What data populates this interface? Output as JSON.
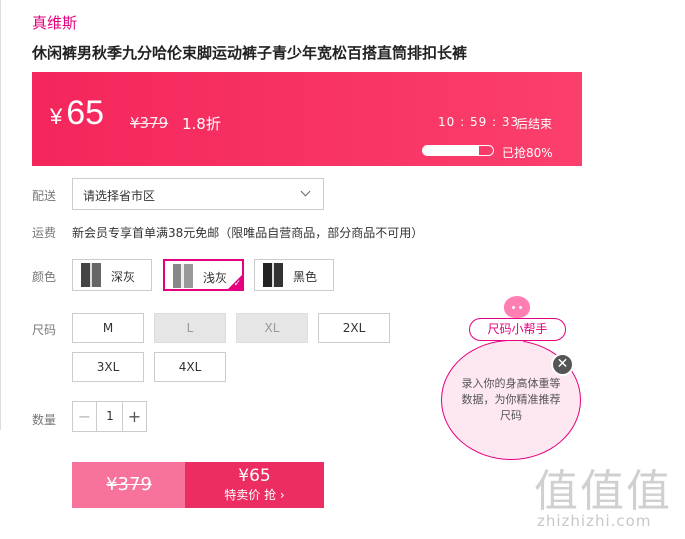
{
  "brand": "真维斯",
  "product_title": "休闲裤男秋季九分哈伦束脚运动裤子青少年宽松百搭直筒排扣长裤",
  "banner": {
    "currency": "¥",
    "price": "65",
    "original_price": "¥379",
    "discount": "1.8折",
    "countdown": "10 : 59 : 33",
    "ends_label": "后结束",
    "sold_label": "已抢80%",
    "sold_fraction": 0.8,
    "colors": {
      "start": "#f4265b",
      "end": "#fb3f6c"
    }
  },
  "delivery": {
    "label": "配送",
    "select_value": "请选择省市区"
  },
  "shipping": {
    "label": "运费",
    "text": "新会员专享首单满38元免邮（限唯品自营商品，部分商品不可用）"
  },
  "color": {
    "label": "颜色",
    "options": [
      {
        "name": "深灰",
        "selected": false
      },
      {
        "name": "浅灰",
        "selected": true
      },
      {
        "name": "黑色",
        "selected": false
      }
    ]
  },
  "size": {
    "label": "尺码",
    "options": [
      {
        "name": "M",
        "disabled": false
      },
      {
        "name": "L",
        "disabled": true
      },
      {
        "name": "XL",
        "disabled": true
      },
      {
        "name": "2XL",
        "disabled": false
      },
      {
        "name": "3XL",
        "disabled": false
      },
      {
        "name": "4XL",
        "disabled": false
      }
    ]
  },
  "quantity": {
    "label": "数量",
    "value": "1",
    "minus": "−",
    "plus": "+"
  },
  "buy": {
    "original_price": "¥379",
    "price": "¥65",
    "action": "特卖价 抢 ›"
  },
  "size_helper": {
    "title": "尺码小帮手",
    "text": "录入你的身高体重等数据，为你精准推荐尺码",
    "close": "✕"
  },
  "watermark": {
    "logo": "值值值",
    "url": "zhizhizhi.com"
  },
  "accent_color": "#e4007f"
}
